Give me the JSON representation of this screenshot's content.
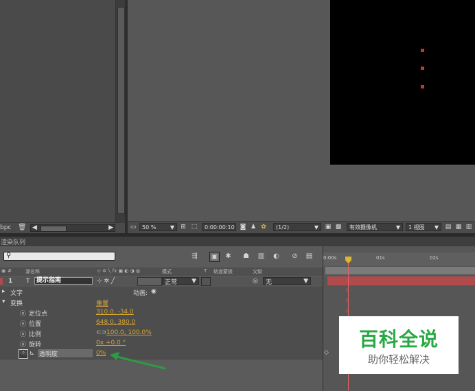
{
  "project": {
    "bpc_label": "bpc"
  },
  "comp_toolbar": {
    "zoom": "50 %",
    "timecode": "0:00:00:10",
    "resolution": "(1/2)",
    "camera": "有效摄像机",
    "views": "1 视图"
  },
  "timeline": {
    "tab_label": "渲染队列",
    "search_placeholder": "",
    "header": {
      "num": "#",
      "source_name": "源名称",
      "mode": "模式",
      "t": "T",
      "track_matte": "轨道蒙板",
      "parent": "父级"
    },
    "layer": {
      "number": "1",
      "type_icon": "T",
      "name": "提示指南",
      "mode": "正常",
      "parent": "无"
    },
    "rows": {
      "text": "文字",
      "animate": "动画:",
      "transform": "变换",
      "reset": "重置",
      "anchor_label": "定位点",
      "anchor_value": "310.0, -34.0",
      "position_label": "位置",
      "position_value": "648.0, 380.0",
      "scale_label": "比例",
      "scale_value": "100.0, 100.0%",
      "rotation_label": "旋转",
      "rotation_value": "0x +0.0 °",
      "opacity_label": "透明度",
      "opacity_value": "0%"
    },
    "ruler": {
      "t0": "0:00s",
      "t1": "01s",
      "t2": "02s"
    }
  },
  "watermark": {
    "title": "百科全说",
    "subtitle": "助你轻松解决"
  },
  "colors": {
    "layer_bar": "#b14b4b",
    "cti": "#e3b52b",
    "value_yellow": "#d7a632",
    "watermark_green": "#2aa844",
    "arrow": "#2e9a46"
  }
}
